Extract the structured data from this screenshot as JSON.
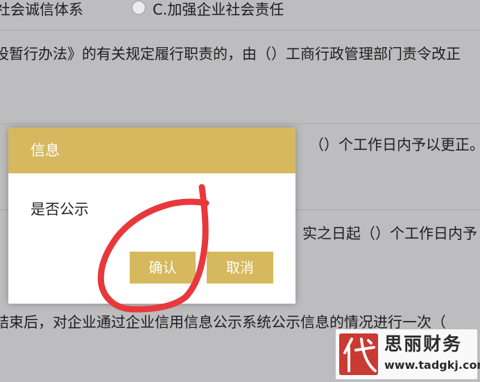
{
  "background": {
    "lines": [
      {
        "id": "line-1a",
        "text": "社会诚信体系"
      },
      {
        "id": "line-1b",
        "text": "C.加强企业社会责任"
      },
      {
        "id": "line-2",
        "text": "设暂行办法》的有关规定履行职责的，由（）工商行政管理部门责令改正"
      },
      {
        "id": "line-3",
        "text": "（）个工作日内予以更正。"
      },
      {
        "id": "line-4",
        "text": "实之日起（）个工作日内予"
      },
      {
        "id": "line-5",
        "text": "结束后，对企业通过企业信用信息公示系统公示信息的情况进行一次（"
      }
    ]
  },
  "dialog": {
    "title": "信息",
    "message": "是否公示",
    "confirm_label": "确认",
    "cancel_label": "取消"
  },
  "watermark": {
    "seal_char": "代",
    "brand": "思丽财务",
    "url": "www.tadgkj.com"
  },
  "colors": {
    "accent": "#d6b95f",
    "overlay_bg": "#bdbcbe",
    "annotation": "#e8383c",
    "seal": "#c93a33"
  }
}
